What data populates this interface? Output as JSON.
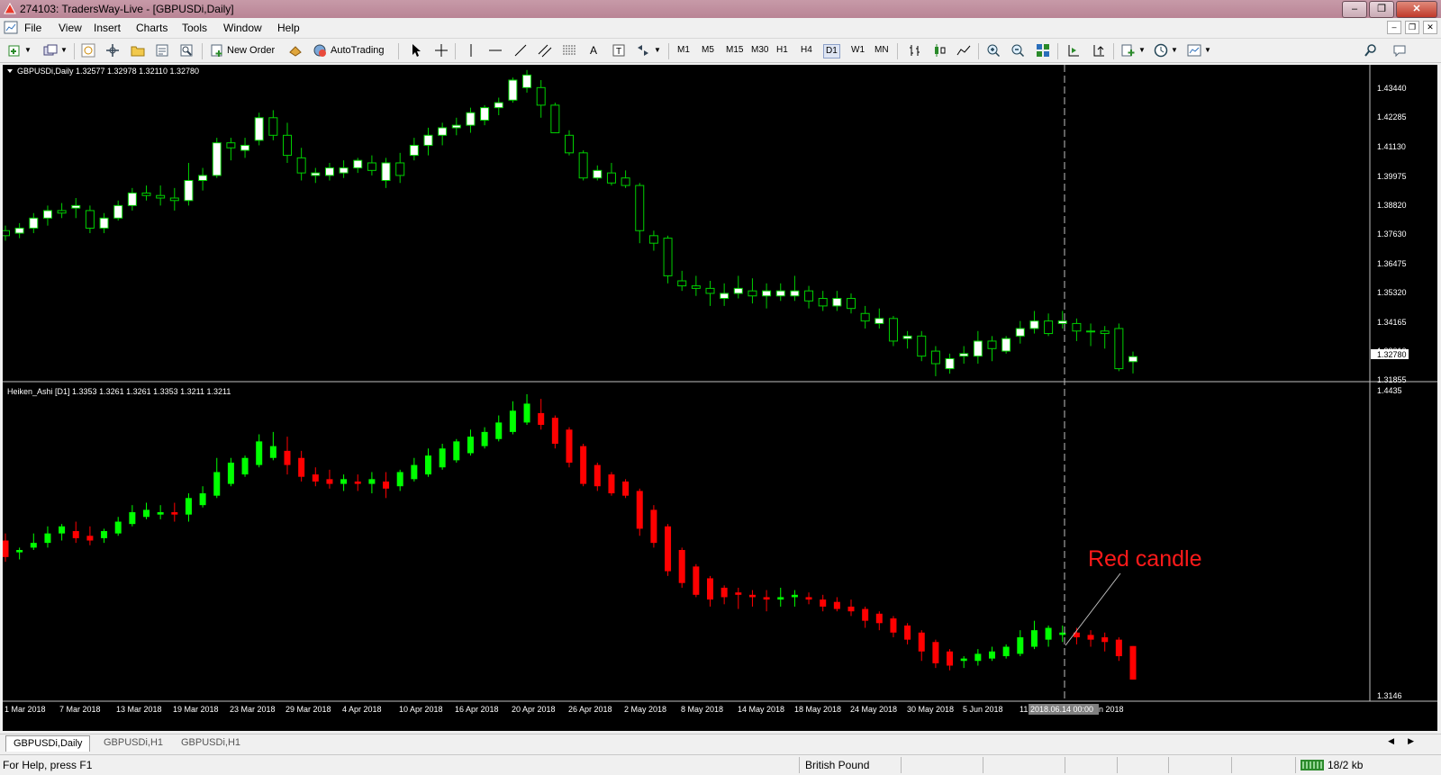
{
  "window": {
    "title": "274103: TradersWay-Live - [GBPUSDi,Daily]"
  },
  "menu": [
    "File",
    "View",
    "Insert",
    "Charts",
    "Tools",
    "Window",
    "Help"
  ],
  "toolbar": {
    "new_order": "New Order",
    "auto_trading": "AutoTrading",
    "timeframes": [
      "M1",
      "M5",
      "M15",
      "M30",
      "H1",
      "H4",
      "D1",
      "W1",
      "MN"
    ],
    "selected_timeframe": "D1"
  },
  "main_chart": {
    "label": "GBPUSDi,Daily  1.32577 1.32978 1.32110 1.32780",
    "price_labels": [
      "1.43440",
      "1.42285",
      "1.41130",
      "1.39975",
      "1.38820",
      "1.37630",
      "1.36475",
      "1.35320",
      "1.34165",
      "1.33010",
      "1.31855"
    ],
    "current_price": "1.32780",
    "bull_color": "#ffffff",
    "bear_color": "#000000",
    "wick_color": "#00d000"
  },
  "indicator": {
    "label": "Heiken_Ashi [D1]  1.3353 1.3261 1.3261 1.3353 1.3211 1.3211",
    "axis_top": "1.4435",
    "axis_bottom": "1.3146",
    "up_color": "#00ff00",
    "down_color": "#ff0000"
  },
  "date_axis": {
    "labels": [
      "1 Mar 2018",
      "7 Mar 2018",
      "13 Mar 2018",
      "19 Mar 2018",
      "23 Mar 2018",
      "29 Mar 2018",
      "4 Apr 2018",
      "10 Apr 2018",
      "16 Apr 2018",
      "20 Apr 2018",
      "26 Apr 2018",
      "2 May 2018",
      "8 May 2018",
      "14 May 2018",
      "18 May 2018",
      "24 May 2018",
      "30 May 2018",
      "5 Jun 2018"
    ],
    "crosshair_date": "2018.06.14 00:00",
    "prefix_fragment": "11",
    "suffix_fragment": "n 2018"
  },
  "annotation": {
    "text": "Red candle",
    "color": "#ff1a1a"
  },
  "tabs": [
    "GBPUSDi,Daily",
    "GBPUSDi,H1",
    "GBPUSDi,H1"
  ],
  "status": {
    "help": "For Help, press F1",
    "symbol": "British Pound",
    "traffic": "18/2 kb"
  },
  "chart_data": {
    "type": "candlestick",
    "symbol": "GBPUSDi",
    "timeframe": "Daily",
    "ylim": [
      1.31855,
      1.4344
    ],
    "ohlc": [
      [
        1.378,
        1.38,
        1.374,
        1.376
      ],
      [
        1.377,
        1.381,
        1.375,
        1.379
      ],
      [
        1.379,
        1.385,
        1.377,
        1.383
      ],
      [
        1.383,
        1.388,
        1.38,
        1.386
      ],
      [
        1.386,
        1.389,
        1.383,
        1.385
      ],
      [
        1.387,
        1.391,
        1.383,
        1.388
      ],
      [
        1.386,
        1.388,
        1.377,
        1.379
      ],
      [
        1.379,
        1.385,
        1.377,
        1.383
      ],
      [
        1.383,
        1.39,
        1.382,
        1.388
      ],
      [
        1.388,
        1.395,
        1.386,
        1.393
      ],
      [
        1.393,
        1.396,
        1.39,
        1.392
      ],
      [
        1.392,
        1.396,
        1.388,
        1.391
      ],
      [
        1.391,
        1.395,
        1.386,
        1.39
      ],
      [
        1.39,
        1.405,
        1.388,
        1.398
      ],
      [
        1.398,
        1.403,
        1.394,
        1.4
      ],
      [
        1.4,
        1.415,
        1.399,
        1.413
      ],
      [
        1.413,
        1.415,
        1.406,
        1.411
      ],
      [
        1.41,
        1.415,
        1.407,
        1.412
      ],
      [
        1.414,
        1.425,
        1.412,
        1.423
      ],
      [
        1.423,
        1.426,
        1.414,
        1.416
      ],
      [
        1.416,
        1.421,
        1.405,
        1.408
      ],
      [
        1.407,
        1.411,
        1.398,
        1.401
      ],
      [
        1.4,
        1.403,
        1.397,
        1.401
      ],
      [
        1.4,
        1.405,
        1.398,
        1.403
      ],
      [
        1.401,
        1.406,
        1.399,
        1.403
      ],
      [
        1.403,
        1.407,
        1.401,
        1.406
      ],
      [
        1.405,
        1.408,
        1.4,
        1.402
      ],
      [
        1.398,
        1.407,
        1.395,
        1.405
      ],
      [
        1.405,
        1.409,
        1.397,
        1.4
      ],
      [
        1.408,
        1.415,
        1.406,
        1.412
      ],
      [
        1.412,
        1.419,
        1.408,
        1.416
      ],
      [
        1.416,
        1.421,
        1.412,
        1.419
      ],
      [
        1.419,
        1.423,
        1.416,
        1.42
      ],
      [
        1.42,
        1.427,
        1.417,
        1.425
      ],
      [
        1.422,
        1.428,
        1.42,
        1.427
      ],
      [
        1.427,
        1.431,
        1.424,
        1.429
      ],
      [
        1.43,
        1.439,
        1.429,
        1.438
      ],
      [
        1.435,
        1.442,
        1.433,
        1.44
      ],
      [
        1.435,
        1.438,
        1.423,
        1.428
      ],
      [
        1.428,
        1.429,
        1.417,
        1.417
      ],
      [
        1.416,
        1.418,
        1.408,
        1.409
      ],
      [
        1.409,
        1.41,
        1.398,
        1.399
      ],
      [
        1.399,
        1.404,
        1.398,
        1.402
      ],
      [
        1.401,
        1.405,
        1.396,
        1.397
      ],
      [
        1.399,
        1.402,
        1.395,
        1.396
      ],
      [
        1.396,
        1.397,
        1.373,
        1.378
      ],
      [
        1.376,
        1.378,
        1.37,
        1.373
      ],
      [
        1.375,
        1.376,
        1.357,
        1.36
      ],
      [
        1.358,
        1.362,
        1.354,
        1.356
      ],
      [
        1.356,
        1.36,
        1.352,
        1.355
      ],
      [
        1.355,
        1.358,
        1.348,
        1.353
      ],
      [
        1.351,
        1.357,
        1.348,
        1.353
      ],
      [
        1.353,
        1.36,
        1.351,
        1.355
      ],
      [
        1.354,
        1.359,
        1.349,
        1.352
      ],
      [
        1.352,
        1.357,
        1.347,
        1.354
      ],
      [
        1.352,
        1.357,
        1.35,
        1.354
      ],
      [
        1.352,
        1.36,
        1.35,
        1.354
      ],
      [
        1.354,
        1.356,
        1.347,
        1.35
      ],
      [
        1.351,
        1.354,
        1.346,
        1.348
      ],
      [
        1.348,
        1.354,
        1.346,
        1.351
      ],
      [
        1.351,
        1.353,
        1.345,
        1.347
      ],
      [
        1.345,
        1.348,
        1.339,
        1.342
      ],
      [
        1.341,
        1.347,
        1.339,
        1.343
      ],
      [
        1.343,
        1.344,
        1.332,
        1.334
      ],
      [
        1.335,
        1.338,
        1.331,
        1.336
      ],
      [
        1.336,
        1.338,
        1.326,
        1.328
      ],
      [
        1.33,
        1.332,
        1.32,
        1.325
      ],
      [
        1.323,
        1.329,
        1.321,
        1.327
      ],
      [
        1.328,
        1.332,
        1.325,
        1.329
      ],
      [
        1.328,
        1.338,
        1.325,
        1.334
      ],
      [
        1.334,
        1.336,
        1.326,
        1.331
      ],
      [
        1.33,
        1.336,
        1.329,
        1.335
      ],
      [
        1.336,
        1.342,
        1.333,
        1.339
      ],
      [
        1.339,
        1.346,
        1.337,
        1.342
      ],
      [
        1.342,
        1.345,
        1.336,
        1.337
      ],
      [
        1.341,
        1.346,
        1.339,
        1.342
      ],
      [
        1.341,
        1.343,
        1.334,
        1.338
      ],
      [
        1.338,
        1.341,
        1.332,
        1.338
      ],
      [
        1.338,
        1.34,
        1.331,
        1.337
      ],
      [
        1.339,
        1.341,
        1.322,
        1.323
      ],
      [
        1.3258,
        1.3298,
        1.3211,
        1.3278
      ]
    ],
    "heiken_ashi": [
      [
        1.38,
        1.383,
        1.371,
        1.373
      ],
      [
        1.375,
        1.377,
        1.372,
        1.376
      ],
      [
        1.377,
        1.383,
        1.376,
        1.379
      ],
      [
        1.379,
        1.386,
        1.377,
        1.383
      ],
      [
        1.383,
        1.387,
        1.38,
        1.386
      ],
      [
        1.384,
        1.388,
        1.379,
        1.381
      ],
      [
        1.382,
        1.386,
        1.378,
        1.38
      ],
      [
        1.381,
        1.385,
        1.379,
        1.384
      ],
      [
        1.383,
        1.39,
        1.382,
        1.388
      ],
      [
        1.387,
        1.395,
        1.386,
        1.392
      ],
      [
        1.39,
        1.396,
        1.389,
        1.393
      ],
      [
        1.391,
        1.395,
        1.389,
        1.392
      ],
      [
        1.392,
        1.396,
        1.388,
        1.391
      ],
      [
        1.391,
        1.4,
        1.388,
        1.398
      ],
      [
        1.395,
        1.403,
        1.394,
        1.4
      ],
      [
        1.399,
        1.415,
        1.398,
        1.409
      ],
      [
        1.404,
        1.415,
        1.403,
        1.413
      ],
      [
        1.408,
        1.416,
        1.407,
        1.415
      ],
      [
        1.412,
        1.425,
        1.411,
        1.422
      ],
      [
        1.415,
        1.426,
        1.414,
        1.42
      ],
      [
        1.418,
        1.424,
        1.408,
        1.412
      ],
      [
        1.415,
        1.418,
        1.405,
        1.407
      ],
      [
        1.408,
        1.411,
        1.403,
        1.405
      ],
      [
        1.406,
        1.41,
        1.402,
        1.404
      ],
      [
        1.404,
        1.408,
        1.401,
        1.406
      ],
      [
        1.405,
        1.408,
        1.401,
        1.404
      ],
      [
        1.404,
        1.409,
        1.4,
        1.406
      ],
      [
        1.405,
        1.409,
        1.398,
        1.402
      ],
      [
        1.403,
        1.41,
        1.401,
        1.409
      ],
      [
        1.406,
        1.415,
        1.405,
        1.412
      ],
      [
        1.408,
        1.419,
        1.407,
        1.416
      ],
      [
        1.411,
        1.421,
        1.41,
        1.419
      ],
      [
        1.414,
        1.423,
        1.413,
        1.422
      ],
      [
        1.417,
        1.427,
        1.416,
        1.424
      ],
      [
        1.42,
        1.428,
        1.419,
        1.426
      ],
      [
        1.423,
        1.433,
        1.422,
        1.43
      ],
      [
        1.426,
        1.439,
        1.425,
        1.435
      ],
      [
        1.43,
        1.442,
        1.429,
        1.438
      ],
      [
        1.434,
        1.44,
        1.427,
        1.429
      ],
      [
        1.432,
        1.433,
        1.419,
        1.421
      ],
      [
        1.427,
        1.428,
        1.411,
        1.413
      ],
      [
        1.42,
        1.421,
        1.403,
        1.404
      ],
      [
        1.412,
        1.413,
        1.401,
        1.403
      ],
      [
        1.408,
        1.409,
        1.399,
        1.4
      ],
      [
        1.405,
        1.406,
        1.398,
        1.399
      ],
      [
        1.401,
        1.402,
        1.382,
        1.385
      ],
      [
        1.393,
        1.395,
        1.377,
        1.379
      ],
      [
        1.386,
        1.387,
        1.365,
        1.367
      ],
      [
        1.376,
        1.377,
        1.36,
        1.362
      ],
      [
        1.369,
        1.37,
        1.356,
        1.357
      ],
      [
        1.364,
        1.365,
        1.352,
        1.355
      ],
      [
        1.36,
        1.361,
        1.353,
        1.356
      ],
      [
        1.358,
        1.36,
        1.351,
        1.357
      ],
      [
        1.357,
        1.359,
        1.352,
        1.356
      ],
      [
        1.356,
        1.359,
        1.35,
        1.355
      ],
      [
        1.355,
        1.36,
        1.352,
        1.356
      ],
      [
        1.356,
        1.359,
        1.352,
        1.357
      ],
      [
        1.356,
        1.358,
        1.353,
        1.355
      ],
      [
        1.355,
        1.357,
        1.35,
        1.352
      ],
      [
        1.354,
        1.356,
        1.35,
        1.351
      ],
      [
        1.352,
        1.355,
        1.348,
        1.35
      ],
      [
        1.351,
        1.352,
        1.343,
        1.346
      ],
      [
        1.349,
        1.35,
        1.342,
        1.345
      ],
      [
        1.347,
        1.348,
        1.339,
        1.341
      ],
      [
        1.344,
        1.345,
        1.336,
        1.338
      ],
      [
        1.341,
        1.342,
        1.329,
        1.333
      ],
      [
        1.337,
        1.338,
        1.326,
        1.328
      ],
      [
        1.333,
        1.334,
        1.325,
        1.327
      ],
      [
        1.329,
        1.331,
        1.326,
        1.33
      ],
      [
        1.329,
        1.334,
        1.327,
        1.332
      ],
      [
        1.33,
        1.335,
        1.329,
        1.333
      ],
      [
        1.331,
        1.336,
        1.33,
        1.335
      ],
      [
        1.332,
        1.342,
        1.331,
        1.339
      ],
      [
        1.335,
        1.346,
        1.334,
        1.342
      ],
      [
        1.338,
        1.344,
        1.335,
        1.343
      ],
      [
        1.34,
        1.344,
        1.337,
        1.341
      ],
      [
        1.341,
        1.343,
        1.336,
        1.339
      ],
      [
        1.34,
        1.342,
        1.335,
        1.338
      ],
      [
        1.339,
        1.341,
        1.333,
        1.337
      ],
      [
        1.338,
        1.339,
        1.329,
        1.331
      ],
      [
        1.3353,
        1.3353,
        1.3211,
        1.3211
      ]
    ]
  }
}
